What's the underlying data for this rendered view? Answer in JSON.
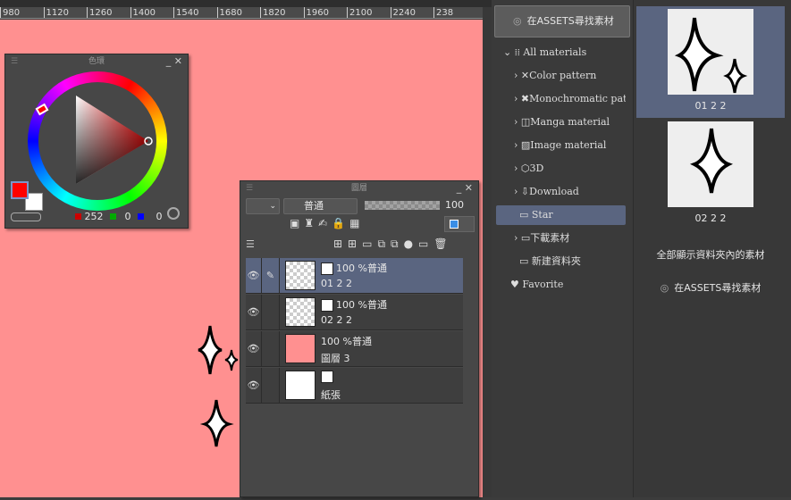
{
  "ruler": {
    "ticks": [
      "980",
      "1120",
      "1260",
      "1400",
      "1540",
      "1680",
      "1820",
      "1960",
      "2100",
      "2240",
      "238"
    ]
  },
  "canvas": {
    "background": "#ff9090"
  },
  "color_panel": {
    "title": "色環",
    "rgb": {
      "r": "252",
      "g": "0",
      "b": "0"
    },
    "main_color": "#ff0000",
    "sub_color": "#ffffff"
  },
  "layer_panel": {
    "title": "圖層",
    "blend_mode": "普通",
    "opacity": "100",
    "layers": [
      {
        "mode": "100 %普通",
        "name": "01 2 2",
        "thumb": "transparent",
        "selected": true
      },
      {
        "mode": "100 %普通",
        "name": "02 2 2",
        "thumb": "transparent",
        "selected": false
      },
      {
        "mode": "100 %普通",
        "name": "圖層 3",
        "thumb": "#ff9090",
        "selected": false
      },
      {
        "mode": "",
        "name": "紙張",
        "thumb": "#ffffff",
        "selected": false
      }
    ]
  },
  "materials": {
    "assets_button": "在ASSETS尋找素材",
    "tree": [
      {
        "label": "All materials",
        "icon": "grid-icon"
      },
      {
        "label": "Color pattern",
        "icon": "pattern-icon"
      },
      {
        "label": "Monochromatic patt",
        "icon": "mono-pattern-icon"
      },
      {
        "label": "Manga material",
        "icon": "manga-icon"
      },
      {
        "label": "Image material",
        "icon": "image-icon"
      },
      {
        "label": "3D",
        "icon": "cube-icon"
      },
      {
        "label": "Download",
        "icon": "download-icon"
      },
      {
        "label": "Star",
        "icon": "folder-icon"
      },
      {
        "label": "下載素材",
        "icon": "folder-icon"
      },
      {
        "label": "新建資料夾",
        "icon": "folder-icon"
      },
      {
        "label": "Favorite",
        "icon": "heart-icon"
      }
    ],
    "items": [
      {
        "label": "01 2 2"
      },
      {
        "label": "02 2 2"
      }
    ],
    "show_all": "全部顯示資料夾內的素材",
    "assets_link": "在ASSETS尋找素材"
  }
}
